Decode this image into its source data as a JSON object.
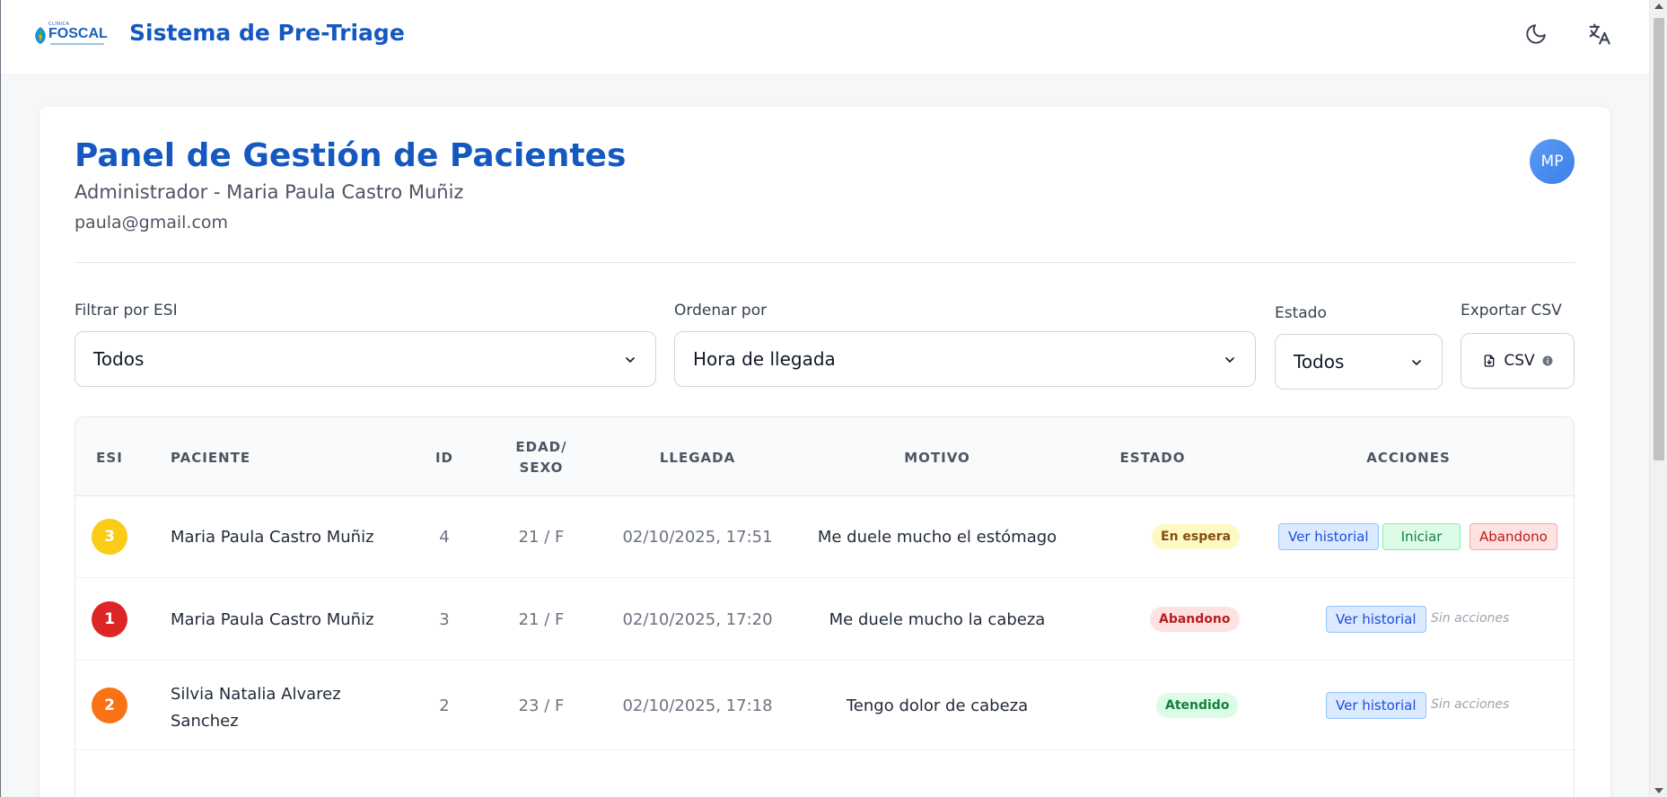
{
  "header": {
    "logo_small": "CLÍNICA",
    "logo_brand": "FOSCAL",
    "app_title": "Sistema de Pre-Triage",
    "icons": [
      "moon-icon",
      "translate-icon"
    ]
  },
  "panel": {
    "title": "Panel de Gestión de Pacientes",
    "subtitle": "Administrador - Maria Paula Castro Muñiz",
    "email": "paula@gmail.com",
    "avatar_initials": "MP"
  },
  "filters": {
    "esi_label": "Filtrar por ESI",
    "esi_value": "Todos",
    "order_label": "Ordenar por",
    "order_value": "Hora de llegada",
    "estado_label": "Estado",
    "estado_value": "Todos",
    "export_label": "Exportar CSV",
    "export_button": "CSV"
  },
  "table": {
    "headers": {
      "esi": "ESI",
      "paciente": "PACIENTE",
      "id": "ID",
      "edad1": "EDAD/",
      "edad2": "SEXO",
      "llegada": "LLEGADA",
      "motivo": "MOTIVO",
      "estado": "ESTADO",
      "acciones": "ACCIONES"
    },
    "rows": [
      {
        "esi": "3",
        "esi_color": "#facc15",
        "paciente_l1": "Maria Paula Castro Muñiz",
        "paciente_l2": "",
        "id": "4",
        "edad": "21 / F",
        "llegada": "02/10/2025, 17:51",
        "motivo": "Me duele mucho el estómago",
        "estado": "En espera",
        "btn_hist": "Ver historial",
        "btn_start": "Iniciar",
        "btn_abandon": "Abandono"
      },
      {
        "esi": "1",
        "esi_color": "#dc2626",
        "paciente_l1": "Maria Paula Castro Muñiz",
        "paciente_l2": "",
        "id": "3",
        "edad": "21 / F",
        "llegada": "02/10/2025, 17:20",
        "motivo": "Me duele mucho la cabeza",
        "estado": "Abandono",
        "btn_hist": "Ver historial",
        "no_actions": "Sin acciones"
      },
      {
        "esi": "2",
        "esi_color": "#f97316",
        "paciente_l1": "Silvia Natalia Alvarez",
        "paciente_l2": "Sanchez",
        "id": "2",
        "edad": "23 / F",
        "llegada": "02/10/2025, 17:18",
        "motivo": "Tengo dolor de cabeza",
        "estado": "Atendido",
        "btn_hist": "Ver historial",
        "no_actions": "Sin acciones"
      }
    ]
  },
  "colors": {
    "brand": "#1558c0",
    "status_waiting_bg": "#fef9c3",
    "status_waiting_fg": "#854d0e",
    "status_abandon_bg": "#fee2e2",
    "status_abandon_fg": "#b91c1c",
    "status_done_bg": "#dcfce7",
    "status_done_fg": "#15803d"
  }
}
